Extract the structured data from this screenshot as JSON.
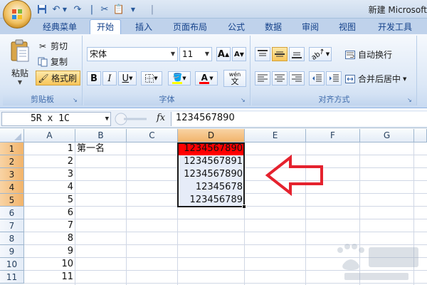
{
  "title_bar": {
    "window_title": "新建 Microsoft"
  },
  "ribbon_tabs": [
    "经典菜单",
    "开始",
    "插入",
    "页面布局",
    "公式",
    "数据",
    "审阅",
    "视图",
    "开发工具"
  ],
  "active_tab": "开始",
  "clipboard": {
    "paste_label": "粘贴",
    "cut_label": "剪切",
    "copy_label": "复制",
    "format_painter_label": "格式刷",
    "group_label": "剪贴板"
  },
  "font": {
    "font_name": "宋体",
    "font_size": "11",
    "bold": "B",
    "italic": "I",
    "underline": "U",
    "font_color_glyph": "A",
    "phonetic_glyph": "wén",
    "group_label": "字体"
  },
  "alignment": {
    "wrap_text_label": "自动换行",
    "merge_center_label": "合并后居中",
    "group_label": "对齐方式"
  },
  "formula_bar": {
    "name_box": "5R x 1C",
    "fx_label": "fx",
    "formula_value": "1234567890"
  },
  "columns": [
    "A",
    "B",
    "C",
    "D",
    "E",
    "F",
    "G"
  ],
  "selected_column": "D",
  "rows": [
    {
      "num": "1",
      "a": "1",
      "b": "第一名",
      "d": "1234567890"
    },
    {
      "num": "2",
      "a": "2",
      "b": "",
      "d": "1234567891"
    },
    {
      "num": "3",
      "a": "3",
      "b": "",
      "d": "1234567890"
    },
    {
      "num": "4",
      "a": "4",
      "b": "",
      "d": "12345678"
    },
    {
      "num": "5",
      "a": "5",
      "b": "",
      "d": "123456789"
    },
    {
      "num": "6",
      "a": "6",
      "b": "",
      "d": ""
    },
    {
      "num": "7",
      "a": "7",
      "b": "",
      "d": ""
    },
    {
      "num": "8",
      "a": "8",
      "b": "",
      "d": ""
    },
    {
      "num": "9",
      "a": "9",
      "b": "",
      "d": ""
    },
    {
      "num": "10",
      "a": "10",
      "b": "",
      "d": ""
    },
    {
      "num": "11",
      "a": "11",
      "b": "",
      "d": ""
    }
  ],
  "selected_rows": [
    "1",
    "2",
    "3",
    "4",
    "5"
  ],
  "colors": {
    "highlight_red": "#ff0000",
    "annotation_arrow": "#e5222e",
    "selection_fill": "#e6ecf8"
  }
}
